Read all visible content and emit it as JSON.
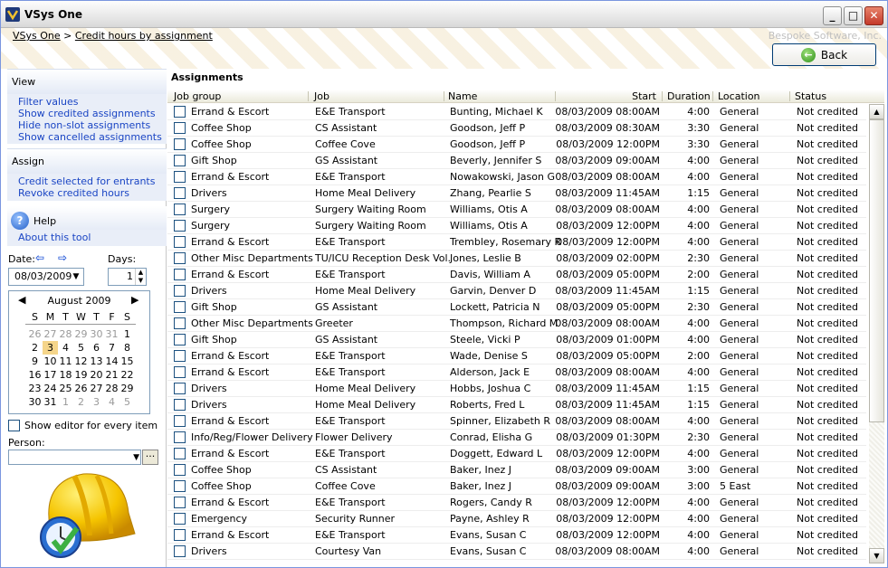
{
  "window": {
    "title": "VSys One",
    "minimize": "_",
    "maximize": "□",
    "close": "✕"
  },
  "breadcrumb": {
    "root": "VSys One",
    "sep": ">",
    "current": "Credit hours by assignment"
  },
  "brand": "Bespoke Software, Inc.",
  "back_label": "Back",
  "sidebar": {
    "view_header": "View",
    "view_links": [
      "Filter values",
      "Show credited assignments",
      "Hide non-slot assignments",
      "Show cancelled assignments"
    ],
    "assign_header": "Assign",
    "assign_links": [
      "Credit selected for entrants",
      "Revoke credited hours"
    ],
    "help_label": "Help",
    "about_link": "About this tool",
    "date_label": "Date:",
    "days_label": "Days:",
    "date_value": "08/03/2009",
    "days_value": "1",
    "show_editor_label": "Show editor for every item",
    "person_label": "Person:",
    "person_value": ""
  },
  "calendar": {
    "month": "August 2009",
    "dow": [
      "S",
      "M",
      "T",
      "W",
      "T",
      "F",
      "S"
    ],
    "weeks": [
      [
        "26",
        "27",
        "28",
        "29",
        "30",
        "31",
        "1"
      ],
      [
        "2",
        "3",
        "4",
        "5",
        "6",
        "7",
        "8"
      ],
      [
        "9",
        "10",
        "11",
        "12",
        "13",
        "14",
        "15"
      ],
      [
        "16",
        "17",
        "18",
        "19",
        "20",
        "21",
        "22"
      ],
      [
        "23",
        "24",
        "25",
        "26",
        "27",
        "28",
        "29"
      ],
      [
        "30",
        "31",
        "1",
        "2",
        "3",
        "4",
        "5"
      ]
    ],
    "selected": "3"
  },
  "main": {
    "title": "Assignments",
    "columns": [
      "Job group",
      "Job",
      "Name",
      "Start",
      "Duration",
      "Location",
      "Status"
    ],
    "rows": [
      [
        "Errand & Escort",
        "E&E Transport",
        "Bunting, Michael K",
        "08/03/2009 08:00AM",
        "4:00",
        "General",
        "Not credited"
      ],
      [
        "Coffee Shop",
        "CS Assistant",
        "Goodson, Jeff P",
        "08/03/2009 08:30AM",
        "3:30",
        "General",
        "Not credited"
      ],
      [
        "Coffee Shop",
        "Coffee Cove",
        "Goodson, Jeff P",
        "08/03/2009 12:00PM",
        "3:30",
        "General",
        "Not credited"
      ],
      [
        "Gift Shop",
        "GS Assistant",
        "Beverly, Jennifer S",
        "08/03/2009 09:00AM",
        "4:00",
        "General",
        "Not credited"
      ],
      [
        "Errand & Escort",
        "E&E Transport",
        "Nowakowski, Jason G",
        "08/03/2009 08:00AM",
        "4:00",
        "General",
        "Not credited"
      ],
      [
        "Drivers",
        "Home Meal Delivery",
        "Zhang, Pearlie S",
        "08/03/2009 11:45AM",
        "1:15",
        "General",
        "Not credited"
      ],
      [
        "Surgery",
        "Surgery Waiting Room",
        "Williams, Otis A",
        "08/03/2009 08:00AM",
        "4:00",
        "General",
        "Not credited"
      ],
      [
        "Surgery",
        "Surgery Waiting Room",
        "Williams, Otis A",
        "08/03/2009 12:00PM",
        "4:00",
        "General",
        "Not credited"
      ],
      [
        "Errand & Escort",
        "E&E Transport",
        "Trembley, Rosemary R",
        "08/03/2009 12:00PM",
        "4:00",
        "General",
        "Not credited"
      ],
      [
        "Other Misc Departments",
        "TU/ICU Reception Desk Vol.",
        "Jones, Leslie B",
        "08/03/2009 02:00PM",
        "2:30",
        "General",
        "Not credited"
      ],
      [
        "Errand & Escort",
        "E&E Transport",
        "Davis, William A",
        "08/03/2009 05:00PM",
        "2:00",
        "General",
        "Not credited"
      ],
      [
        "Drivers",
        "Home Meal Delivery",
        "Garvin, Denver D",
        "08/03/2009 11:45AM",
        "1:15",
        "General",
        "Not credited"
      ],
      [
        "Gift Shop",
        "GS Assistant",
        "Lockett, Patricia N",
        "08/03/2009 05:00PM",
        "2:30",
        "General",
        "Not credited"
      ],
      [
        "Other Misc Departments",
        "Greeter",
        "Thompson, Richard M",
        "08/03/2009 08:00AM",
        "4:00",
        "General",
        "Not credited"
      ],
      [
        "Gift Shop",
        "GS Assistant",
        "Steele, Vicki P",
        "08/03/2009 01:00PM",
        "4:00",
        "General",
        "Not credited"
      ],
      [
        "Errand & Escort",
        "E&E Transport",
        "Wade, Denise S",
        "08/03/2009 05:00PM",
        "2:00",
        "General",
        "Not credited"
      ],
      [
        "Errand & Escort",
        "E&E Transport",
        "Alderson, Jack E",
        "08/03/2009 08:00AM",
        "4:00",
        "General",
        "Not credited"
      ],
      [
        "Drivers",
        "Home Meal Delivery",
        "Hobbs, Joshua C",
        "08/03/2009 11:45AM",
        "1:15",
        "General",
        "Not credited"
      ],
      [
        "Drivers",
        "Home Meal Delivery",
        "Roberts, Fred L",
        "08/03/2009 11:45AM",
        "1:15",
        "General",
        "Not credited"
      ],
      [
        "Errand & Escort",
        "E&E Transport",
        "Spinner, Elizabeth R",
        "08/03/2009 08:00AM",
        "4:00",
        "General",
        "Not credited"
      ],
      [
        "Info/Reg/Flower Delivery",
        "Flower Delivery",
        "Conrad, Elisha G",
        "08/03/2009 01:30PM",
        "2:30",
        "General",
        "Not credited"
      ],
      [
        "Errand & Escort",
        "E&E Transport",
        "Doggett, Edward L",
        "08/03/2009 12:00PM",
        "4:00",
        "General",
        "Not credited"
      ],
      [
        "Coffee Shop",
        "CS Assistant",
        "Baker, Inez J",
        "08/03/2009 09:00AM",
        "3:00",
        "General",
        "Not credited"
      ],
      [
        "Coffee Shop",
        "Coffee Cove",
        "Baker, Inez J",
        "08/03/2009 09:00AM",
        "3:00",
        "5 East",
        "Not credited"
      ],
      [
        "Errand & Escort",
        "E&E Transport",
        "Rogers, Candy R",
        "08/03/2009 12:00PM",
        "4:00",
        "General",
        "Not credited"
      ],
      [
        "Emergency",
        "Security Runner",
        "Payne, Ashley R",
        "08/03/2009 12:00PM",
        "4:00",
        "General",
        "Not credited"
      ],
      [
        "Errand & Escort",
        "E&E Transport",
        "Evans, Susan C",
        "08/03/2009 12:00PM",
        "4:00",
        "General",
        "Not credited"
      ],
      [
        "Drivers",
        "Courtesy Van",
        "Evans, Susan C",
        "08/03/2009 08:00AM",
        "4:00",
        "General",
        "Not credited"
      ]
    ]
  },
  "colors": {
    "link": "#1a45c4",
    "selected_day": "#f5d58a",
    "panel_link_bg": "#e9eef8"
  }
}
